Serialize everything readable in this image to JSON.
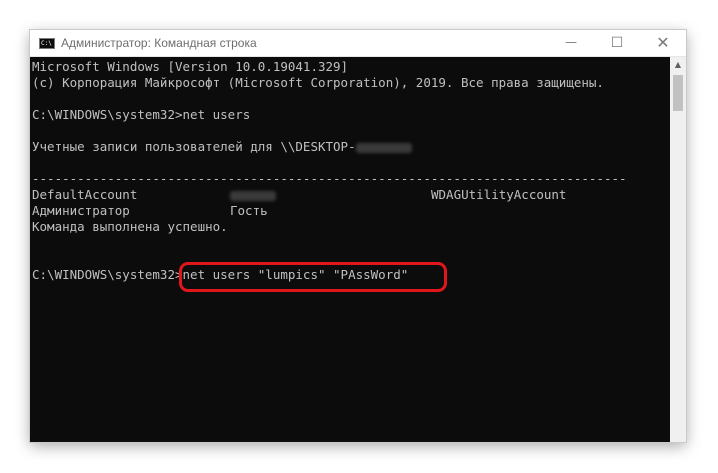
{
  "window": {
    "title": "Администратор: Командная строка",
    "icon_text": "C:\\"
  },
  "controls": {
    "minimize": "—",
    "maximize": "☐",
    "close": "✕"
  },
  "console": {
    "lines": [
      "Microsoft Windows [Version 10.0.19041.329]",
      "(с) Корпорация Майкрософт (Microsoft Corporation), 2019. Все права защищены.",
      "C:\\WINDOWS\\system32>net users",
      "Учетные записи пользователей для \\\\DESKTOP-",
      "-------------------------------------------------------------------------------",
      "Команда выполнена успешно.",
      "C:\\WINDOWS\\system32>net users \"lumpics\" \"PAssWord\""
    ],
    "accounts": {
      "col1": [
        "DefaultAccount",
        "Администратор"
      ],
      "col2": [
        "",
        "Гость"
      ],
      "col3": [
        "WDAGUtilityAccount",
        ""
      ]
    }
  },
  "colors": {
    "console_bg": "#0c0c0c",
    "console_fg": "#c0c0c0",
    "highlight": "#e0161b"
  },
  "icons": {
    "app": "cmd-icon",
    "scroll_up": "scroll-up-arrow-icon"
  }
}
